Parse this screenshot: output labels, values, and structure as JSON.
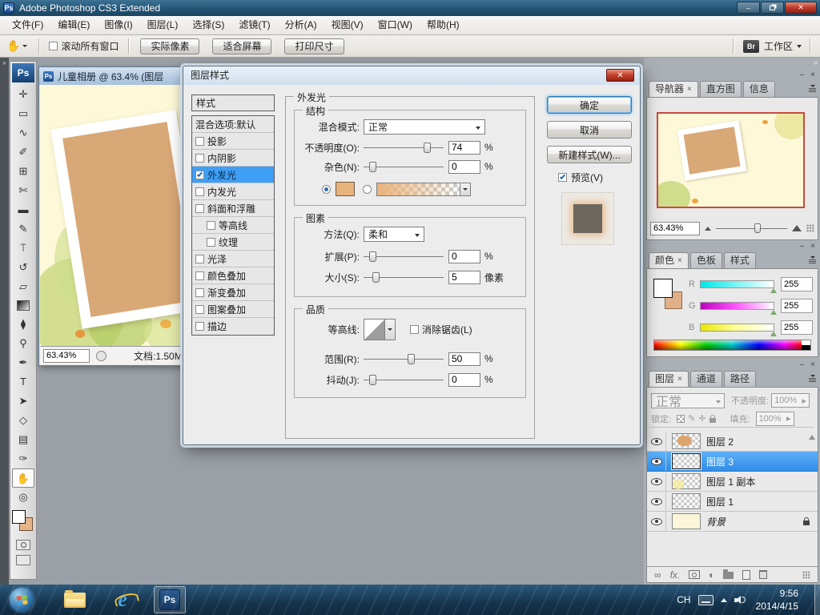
{
  "colors": {
    "accent_blue": "#3f9ef5",
    "titlebar": "#225273",
    "taskbar": "#15344d",
    "canvas_cream": "#fdf8d8",
    "photo_tan": "#d9a877",
    "glow_swatch_tan": "#e9b37c",
    "navigator_border_red": "#c94a3f",
    "selection_blue": "#3b9df2"
  },
  "glyphs": {
    "minimize": "–",
    "close_x": "✕",
    "tab_close": "×",
    "collapse_right": "»",
    "panel_min": "–",
    "panel_close": "×",
    "right_chevron": "▸",
    "link": "∞",
    "fx": "fx.",
    "adjustment": "◐",
    "ellipsis_vert": "⋮"
  },
  "titlebar": {
    "ps_badge": "Ps",
    "app_title": "Adobe Photoshop CS3 Extended"
  },
  "menubar": {
    "items": [
      "文件(F)",
      "编辑(E)",
      "图像(I)",
      "图层(L)",
      "选择(S)",
      "滤镜(T)",
      "分析(A)",
      "视图(V)",
      "窗口(W)",
      "帮助(H)"
    ]
  },
  "optionsbar": {
    "hand_glyph": "✋",
    "scroll_all_windows": "滚动所有窗口",
    "buttons": [
      "实际像素",
      "适合屏幕",
      "打印尺寸"
    ],
    "bridge_icon": "Br",
    "workspace_label": "工作区"
  },
  "toolbox": {
    "logo": "Ps",
    "tools": [
      {
        "name": "move-tool",
        "glyph": "✛"
      },
      {
        "name": "marquee-tool",
        "glyph": "▭"
      },
      {
        "name": "lasso-tool",
        "glyph": "∿"
      },
      {
        "name": "quick-select-tool",
        "glyph": "✐"
      },
      {
        "name": "crop-tool",
        "glyph": "⊞"
      },
      {
        "name": "slice-tool",
        "glyph": "✄"
      },
      {
        "name": "healing-brush-tool",
        "glyph": "▬"
      },
      {
        "name": "brush-tool",
        "glyph": "✎"
      },
      {
        "name": "clone-stamp-tool",
        "glyph": "⍑"
      },
      {
        "name": "history-brush-tool",
        "glyph": "↺"
      },
      {
        "name": "eraser-tool",
        "glyph": "▱"
      },
      {
        "name": "blur-tool",
        "glyph": "⧫"
      },
      {
        "name": "dodge-tool",
        "glyph": "⚲"
      },
      {
        "name": "pen-tool",
        "glyph": "✒"
      },
      {
        "name": "type-tool",
        "glyph": "T"
      },
      {
        "name": "path-selection-tool",
        "glyph": "➤"
      },
      {
        "name": "shape-tool",
        "glyph": "◇"
      },
      {
        "name": "notes-tool",
        "glyph": "▤"
      },
      {
        "name": "eyedropper-tool",
        "glyph": "✑"
      },
      {
        "name": "hand-tool",
        "glyph": "✋"
      },
      {
        "name": "zoom-tool",
        "glyph": "◎"
      }
    ]
  },
  "document": {
    "title": "儿童相册 @ 63.4% (图层",
    "zoom": "63.43%",
    "doc_info": "文档:1.50M"
  },
  "dialog": {
    "title": "图层样式",
    "styles_header": "样式",
    "style_items": [
      {
        "label": "混合选项:默认",
        "type": "header"
      },
      {
        "label": "投影",
        "checked": false
      },
      {
        "label": "内阴影",
        "checked": false
      },
      {
        "label": "外发光",
        "checked": true,
        "selected": true
      },
      {
        "label": "内发光",
        "checked": false
      },
      {
        "label": "斜面和浮雕",
        "checked": false
      },
      {
        "label": "等高线",
        "checked": false,
        "indent": true
      },
      {
        "label": "纹理",
        "checked": false,
        "indent": true
      },
      {
        "label": "光泽",
        "checked": false
      },
      {
        "label": "颜色叠加",
        "checked": false
      },
      {
        "label": "渐变叠加",
        "checked": false
      },
      {
        "label": "图案叠加",
        "checked": false
      },
      {
        "label": "描边",
        "checked": false
      }
    ],
    "group_title": "外发光",
    "structure": {
      "title": "结构",
      "blend_mode_label": "混合模式:",
      "blend_mode_value": "正常",
      "opacity_label": "不透明度(O):",
      "opacity_value": "74",
      "opacity_unit": "%",
      "noise_label": "杂色(N):",
      "noise_value": "0",
      "noise_unit": "%"
    },
    "elements": {
      "title": "图素",
      "technique_label": "方法(Q):",
      "technique_value": "柔和",
      "spread_label": "扩展(P):",
      "spread_value": "0",
      "spread_unit": "%",
      "size_label": "大小(S):",
      "size_value": "5",
      "size_unit": "像素"
    },
    "quality": {
      "title": "品质",
      "contour_label": "等高线:",
      "antialias_label": "消除锯齿(L)",
      "range_label": "范围(R):",
      "range_value": "50",
      "range_unit": "%",
      "jitter_label": "抖动(J):",
      "jitter_value": "0",
      "jitter_unit": "%"
    },
    "ok_label": "确定",
    "cancel_label": "取消",
    "new_style_label": "新建样式(W)...",
    "preview_label": "预览(V)"
  },
  "navigator": {
    "tabs": [
      "导航器",
      "直方图",
      "信息"
    ],
    "zoom": "63.43%"
  },
  "color_panel": {
    "tabs": [
      "颜色",
      "色板",
      "样式"
    ],
    "channels": [
      {
        "label": "R",
        "value": "255"
      },
      {
        "label": "G",
        "value": "255"
      },
      {
        "label": "B",
        "value": "255"
      }
    ]
  },
  "layers_panel": {
    "tabs": [
      "图层",
      "通道",
      "路径"
    ],
    "blend_mode_value": "正常",
    "opacity_label": "不透明度:",
    "opacity_value": "100%",
    "lock_label": "锁定:",
    "fill_label": "填充:",
    "fill_value": "100%",
    "layers": [
      {
        "name": "图层 2"
      },
      {
        "name": "图层 3",
        "selected": true
      },
      {
        "name": "图层 1 副本"
      },
      {
        "name": "图层 1"
      },
      {
        "name": "背景",
        "locked": true
      }
    ]
  },
  "taskbar": {
    "lang": "CH",
    "time": "9:56",
    "date": "2014/4/15"
  }
}
